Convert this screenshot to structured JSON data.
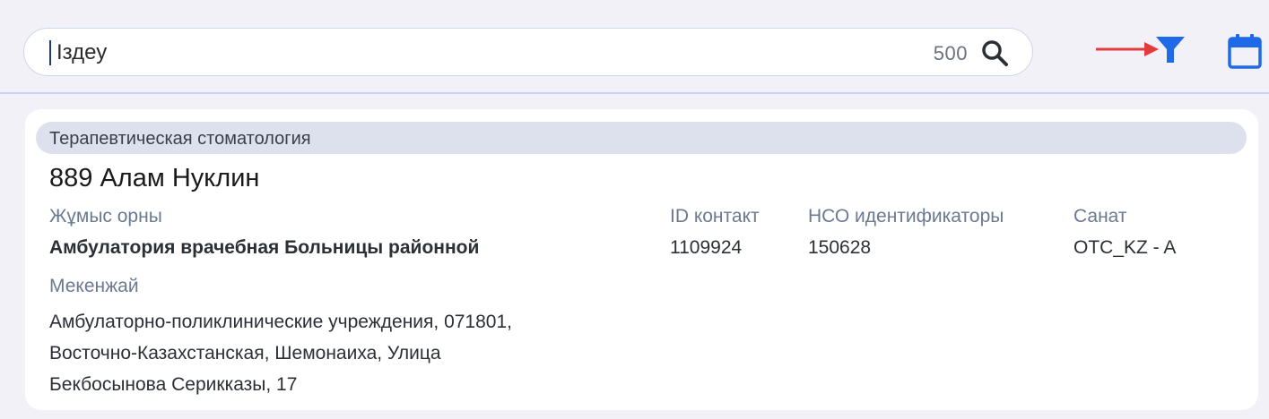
{
  "search": {
    "value": "Іздеу",
    "count": "500"
  },
  "toolbar": {
    "icons": [
      "search-icon",
      "filter-icon",
      "calendar-icon",
      "red-arrow-annotation"
    ],
    "colors": {
      "accent": "#1e6ae8",
      "arrow": "#e23b3b"
    }
  },
  "card": {
    "category": "Терапевтическая стоматология",
    "name": "889 Алам Нуклин",
    "workplace_label": "Жұмыс орны",
    "workplace_value": "Амбулатория врачебная Больницы районной",
    "contact_id_label": "ID контакт",
    "contact_id_value": "1109924",
    "hco_label": "НСО идентификаторы",
    "hco_value": "150628",
    "category_label": "Санат",
    "category_value": "OTC_KZ - A",
    "address_label": "Мекенжай",
    "address_lines": [
      "Амбулаторно-поликлинические учреждения, 071801,",
      "Восточно-Казахстанская, Шемонаиха, Улица",
      "Бекбосынова Серикказы, 17"
    ]
  }
}
